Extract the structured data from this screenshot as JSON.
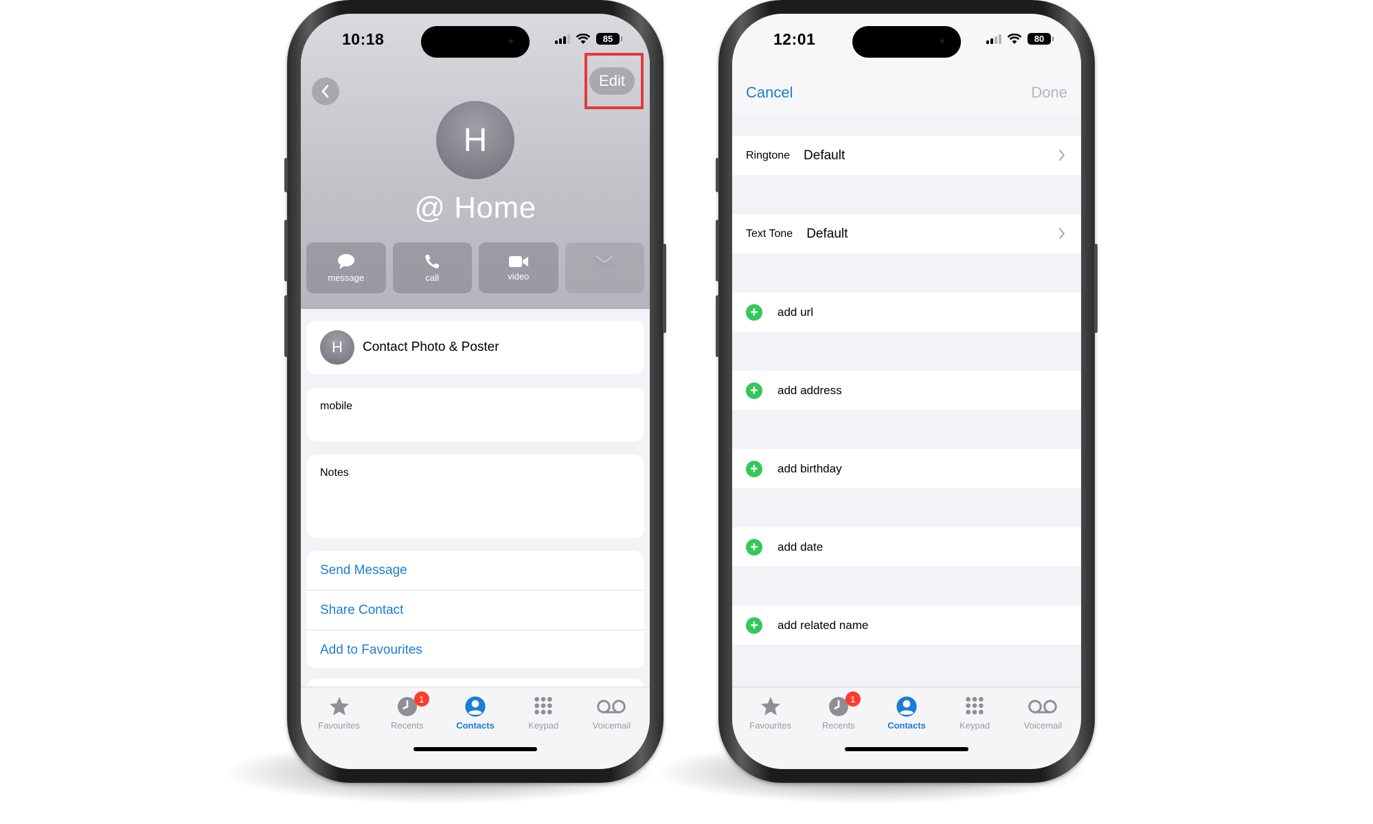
{
  "left_phone": {
    "status": {
      "time": "10:18",
      "battery": "85"
    },
    "top": {
      "edit_label": "Edit"
    },
    "contact": {
      "initial": "H",
      "name": "@ Home"
    },
    "actions": [
      {
        "label": "message",
        "icon": "message-icon"
      },
      {
        "label": "call",
        "icon": "phone-icon"
      },
      {
        "label": "video",
        "icon": "video-icon"
      },
      {
        "label": "mail",
        "icon": "mail-icon"
      }
    ],
    "poster": {
      "initial": "H",
      "label": "Contact Photo & Poster"
    },
    "mobile_label": "mobile",
    "notes_label": "Notes",
    "links": [
      "Send Message",
      "Share Contact",
      "Add to Favourites"
    ]
  },
  "right_phone": {
    "status": {
      "time": "12:01",
      "battery": "80"
    },
    "nav": {
      "cancel": "Cancel",
      "done": "Done"
    },
    "ringtone": {
      "label": "Ringtone",
      "value": "Default"
    },
    "text_tone": {
      "label": "Text Tone",
      "value": "Default"
    },
    "add_items": [
      "add url",
      "add address",
      "add birthday",
      "add date",
      "add related name"
    ]
  },
  "tabbar": {
    "tabs": [
      {
        "label": "Favourites",
        "icon": "star-icon"
      },
      {
        "label": "Recents",
        "icon": "clock-icon",
        "badge": "1"
      },
      {
        "label": "Contacts",
        "icon": "person-circle-icon",
        "active": true
      },
      {
        "label": "Keypad",
        "icon": "keypad-icon"
      },
      {
        "label": "Voicemail",
        "icon": "voicemail-icon"
      }
    ]
  },
  "colors": {
    "accent": "#1a7dd6",
    "highlight": "#e23a3a",
    "add_green": "#34c759",
    "badge_red": "#ff3b30"
  }
}
